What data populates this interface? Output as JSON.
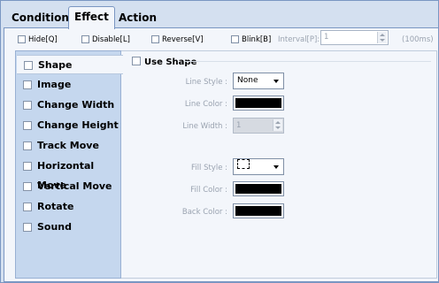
{
  "tabs": [
    {
      "label": "Condition",
      "active": false
    },
    {
      "label": "Effect",
      "active": true
    },
    {
      "label": "Action",
      "active": false
    }
  ],
  "options": {
    "hide": "Hide[Q]",
    "disable": "Disable[L]",
    "reverse": "Reverse[V]",
    "blink": "Blink[B]",
    "interval_label": "Interval[P]:",
    "interval_value": "1",
    "interval_unit": "(100ms)"
  },
  "sidebar": {
    "items": [
      {
        "label": "Shape",
        "selected": true
      },
      {
        "label": "Image"
      },
      {
        "label": "Change Width"
      },
      {
        "label": "Change Height"
      },
      {
        "label": "Track Move"
      },
      {
        "label": "Horizontal Move"
      },
      {
        "label": "Vertical Move"
      },
      {
        "label": "Rotate"
      },
      {
        "label": "Sound"
      }
    ]
  },
  "shape": {
    "use_shape": "Use Shape",
    "line_style_label": "Line Style :",
    "line_style_value": "None",
    "line_color_label": "Line Color :",
    "line_width_label": "Line Width :",
    "line_width_value": "1",
    "fill_style_label": "Fill Style :",
    "fill_color_label": "Fill Color :",
    "back_color_label": "Back Color :",
    "line_color": "#000000",
    "fill_color": "#000000",
    "back_color": "#000000"
  }
}
